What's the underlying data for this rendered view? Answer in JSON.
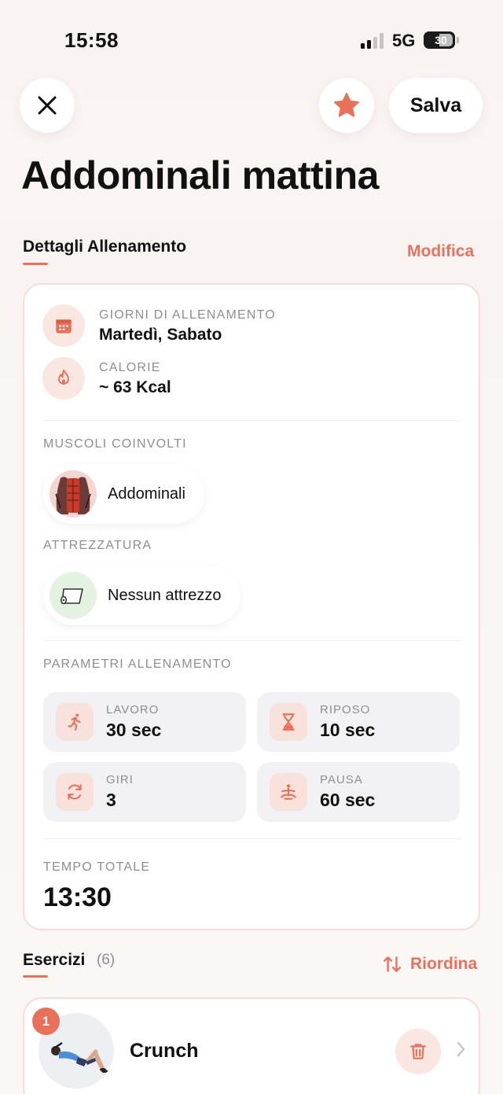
{
  "status_bar": {
    "time": "15:58",
    "network": "5G",
    "battery": "30"
  },
  "header": {
    "save_label": "Salva"
  },
  "workout": {
    "title": "Addominali mattina"
  },
  "details": {
    "section_title": "Dettagli Allenamento",
    "edit_label": "Modifica",
    "training_days": {
      "caption": "GIORNI DI ALLENAMENTO",
      "value": "Martedì, Sabato"
    },
    "calories": {
      "caption": "CALORIE",
      "value": "~ 63 Kcal"
    },
    "muscles": {
      "caption": "MUSCOLI COINVOLTI",
      "items": [
        "Addominali"
      ]
    },
    "equipment": {
      "caption": "ATTREZZATURA",
      "items": [
        "Nessun attrezzo"
      ]
    },
    "parameters": {
      "caption": "PARAMETRI ALLENAMENTO",
      "work": {
        "caption": "LAVORO",
        "value": "30 sec"
      },
      "rest": {
        "caption": "RIPOSO",
        "value": "10 sec"
      },
      "rounds": {
        "caption": "GIRI",
        "value": "3"
      },
      "pause": {
        "caption": "PAUSA",
        "value": "60 sec"
      }
    },
    "total_time": {
      "caption": "TEMPO TOTALE",
      "value": "13:30"
    }
  },
  "exercises": {
    "section_title": "Esercizi",
    "count": "(6)",
    "reorder_label": "Riordina",
    "items": [
      {
        "index": "1",
        "name": "Crunch"
      }
    ]
  },
  "colors": {
    "accent": "#e8715a",
    "accent_soft": "#fbe7e2",
    "card_border": "#f6ddd6"
  }
}
